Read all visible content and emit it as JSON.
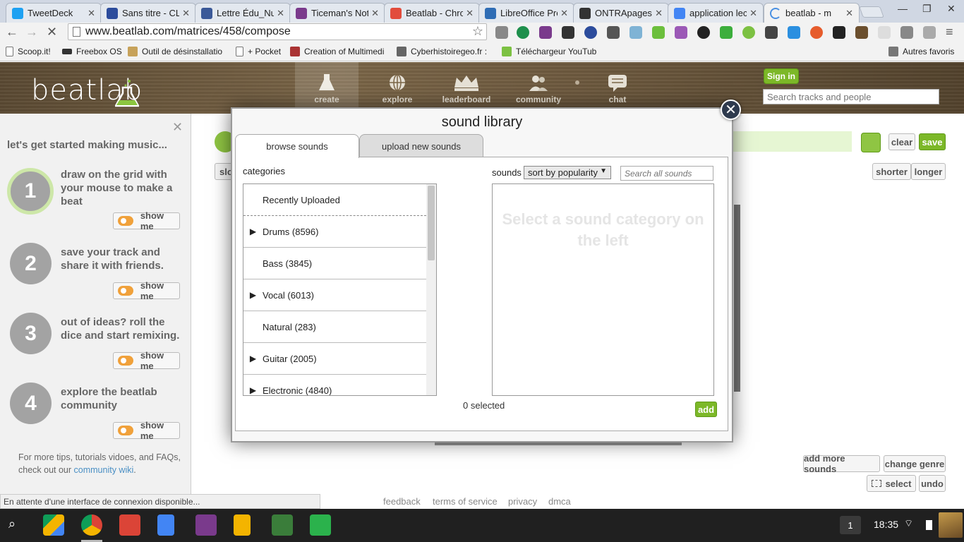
{
  "browser": {
    "tabs": [
      {
        "title": "TweetDeck",
        "color": "#1da1f2"
      },
      {
        "title": "Sans titre - CLIK",
        "color": "#2c4c9c"
      },
      {
        "title": "Lettre Édu_Num",
        "color": "#3b5998"
      },
      {
        "title": "Ticeman's Notebook",
        "color": "#7a3a8c"
      },
      {
        "title": "Beatlab - Chrome",
        "color": "#e24c3c"
      },
      {
        "title": "LibreOffice Pro",
        "color": "#2f6db5"
      },
      {
        "title": "ONTRApages I",
        "color": "#333333"
      },
      {
        "title": "application lec",
        "color": "#4285f4"
      },
      {
        "title": "beatlab - m",
        "color": "#4a90e2"
      }
    ],
    "url": "www.beatlab.com/matrices/458/compose",
    "bookmarks": [
      "Scoop.it!",
      "Freebox OS",
      "Outil de désinstallatio",
      "+ Pocket",
      "Creation of Multimedi",
      "Cyberhistoiregeo.fr : ",
      "Téléchargeur YouTub",
      "Autres favoris"
    ],
    "status": "En attente d'une interface de connexion disponible..."
  },
  "site": {
    "logo": "beatlab",
    "nav": [
      "create",
      "explore",
      "leaderboard",
      "community",
      "chat"
    ],
    "signin": "Sign in",
    "search_placeholder": "Search tracks and people"
  },
  "help": {
    "title": "let's get started making music...",
    "steps": [
      {
        "num": "1",
        "text": "draw on the grid with your mouse to make a beat"
      },
      {
        "num": "2",
        "text": "save your track and share it with friends."
      },
      {
        "num": "3",
        "text": "out of ideas? roll the dice and start remixing."
      },
      {
        "num": "4",
        "text": "explore the beatlab community"
      }
    ],
    "show_me": "show me",
    "foot_text": "For more tips, tutorials vidoes, and FAQs, check out our ",
    "foot_link": "community wiki",
    "foot_end": "."
  },
  "main": {
    "buttons": {
      "clear": "clear",
      "save": "save",
      "shorter": "shorter",
      "longer": "longer",
      "slow": "slo",
      "add_more_sounds": "add more sounds",
      "change_genre": "change genre",
      "select": "select",
      "undo": "undo"
    },
    "footer_links": [
      "feedback",
      "terms of service",
      "privacy",
      "dmca"
    ]
  },
  "modal": {
    "title": "sound library",
    "tabs": [
      "browse sounds",
      "upload new sounds"
    ],
    "categories_label": "categories",
    "categories": [
      {
        "name": "Recently Uploaded",
        "expandable": false
      },
      {
        "name": "Drums (8596)",
        "expandable": true
      },
      {
        "name": "Bass (3845)",
        "expandable": false
      },
      {
        "name": "Vocal (6013)",
        "expandable": true
      },
      {
        "name": "Natural (283)",
        "expandable": false
      },
      {
        "name": "Guitar (2005)",
        "expandable": true
      },
      {
        "name": "Electronic (4840)",
        "expandable": true
      }
    ],
    "sounds_label": "sounds",
    "sort_value": "sort by popularity",
    "search_placeholder": "Search all sounds",
    "empty_message": "Select a sound category on the left",
    "selected_count": "0 selected",
    "add": "add"
  },
  "taskbar": {
    "workspace": "1",
    "clock": "18:35"
  },
  "colors": {
    "accent_green": "#7cb828",
    "modal_close": "#2e3a4e"
  }
}
